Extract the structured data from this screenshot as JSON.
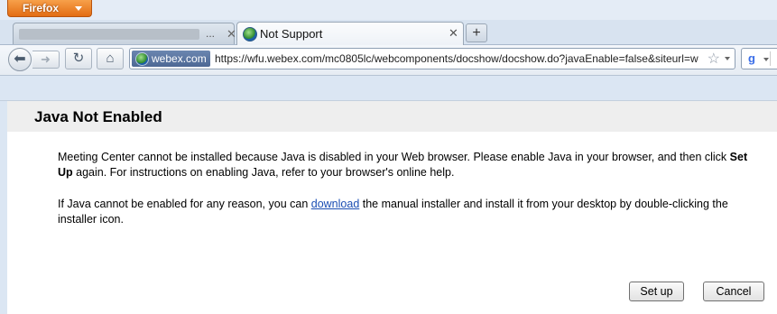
{
  "browser": {
    "menu_button": "Firefox",
    "tabs": [
      {
        "label": "..."
      },
      {
        "label": "Not Support"
      }
    ],
    "new_tab": "+",
    "identity": "webex.com",
    "url": "https://wfu.webex.com/mc0805lc/webcomponents/docshow/docshow.do?javaEnable=false&siteurl=w",
    "search_engine": "g"
  },
  "page": {
    "title": "Java Not Enabled",
    "p1_part1": "Meeting Center cannot be installed because Java is disabled in your Web browser. Please enable Java in your browser, and then click ",
    "p1_bold": "Set Up",
    "p1_part2": " again. For instructions on enabling Java, refer to your browser's online help.",
    "p2_part1": "If Java cannot be enabled for any reason, you can ",
    "p2_link": "download",
    "p2_part2": " the manual installer and install it from your desktop by double-clicking the installer icon.",
    "setup_button": "Set up",
    "cancel_button": "Cancel"
  },
  "colors": {
    "firefox_orange": "#e8761a",
    "link": "#1a4db3",
    "heading_band": "#eeeeee"
  }
}
